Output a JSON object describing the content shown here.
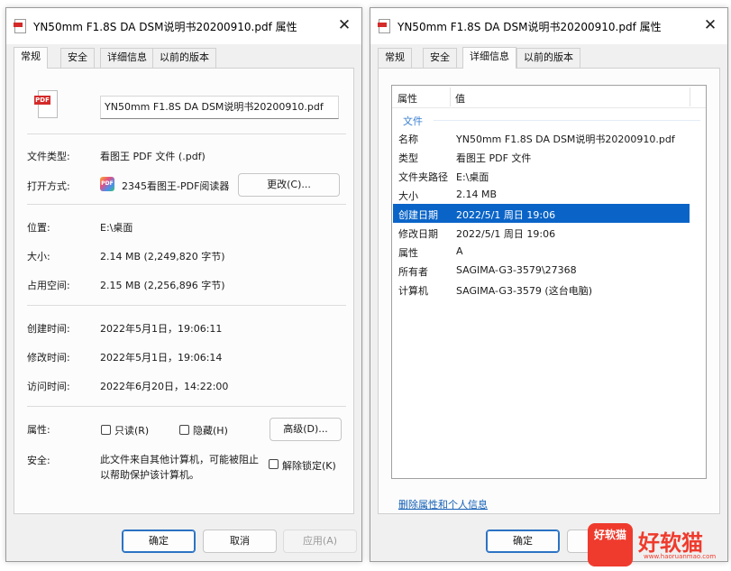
{
  "left_window": {
    "title": "YN50mm F1.8S DA DSM说明书20200910.pdf 属性",
    "tabs": [
      "常规",
      "安全",
      "详细信息",
      "以前的版本"
    ],
    "active_tab": "常规",
    "file_name": "YN50mm F1.8S DA DSM说明书20200910.pdf",
    "file_icon_text": "PDF",
    "file_type_label": "文件类型:",
    "file_type_value": "看图王 PDF 文件 (.pdf)",
    "open_with_label": "打开方式:",
    "open_with_value": "2345看图王-PDF阅读器",
    "app_icon_text": "PDF",
    "change_button": "更改(C)...",
    "location_label": "位置:",
    "location_value": "E:\\桌面",
    "size_label": "大小:",
    "size_value": "2.14 MB (2,249,820 字节)",
    "size_on_disk_label": "占用空间:",
    "size_on_disk_value": "2.15 MB (2,256,896 字节)",
    "created_label": "创建时间:",
    "created_value": "2022年5月1日，19:06:11",
    "modified_label": "修改时间:",
    "modified_value": "2022年5月1日，19:06:14",
    "accessed_label": "访问时间:",
    "accessed_value": "2022年6月20日，14:22:00",
    "attributes_label": "属性:",
    "readonly_label": "只读(R)",
    "hidden_label": "隐藏(H)",
    "advanced_button": "高级(D)...",
    "security_label": "安全:",
    "security_text_1": "此文件来自其他计算机，可能被阻止",
    "security_text_2": "以帮助保护该计算机。",
    "unblock_label": "解除锁定(K)",
    "ok_button": "确定",
    "cancel_button": "取消",
    "apply_button": "应用(A)"
  },
  "right_window": {
    "title": "YN50mm F1.8S DA DSM说明书20200910.pdf 属性",
    "tabs": [
      "常规",
      "安全",
      "详细信息",
      "以前的版本"
    ],
    "active_tab": "详细信息",
    "col_property": "属性",
    "col_value": "值",
    "group_file": "文件",
    "rows": [
      {
        "key": "名称",
        "value": "YN50mm F1.8S DA DSM说明书20200910.pdf"
      },
      {
        "key": "类型",
        "value": "看图王 PDF 文件"
      },
      {
        "key": "文件夹路径",
        "value": "E:\\桌面"
      },
      {
        "key": "大小",
        "value": "2.14 MB"
      },
      {
        "key": "创建日期",
        "value": "2022/5/1 周日 19:06"
      },
      {
        "key": "修改日期",
        "value": "2022/5/1 周日 19:06"
      },
      {
        "key": "属性",
        "value": "A"
      },
      {
        "key": "所有者",
        "value": "SAGIMA-G3-3579\\27368"
      },
      {
        "key": "计算机",
        "value": "SAGIMA-G3-3579 (这台电脑)"
      }
    ],
    "selected_row": "创建日期",
    "remove_link": "删除属性和个人信息",
    "ok_button": "确定"
  },
  "watermark": {
    "badge_text": "好软猫",
    "brand_text": "好软猫",
    "url": "www.haoruanmao.com"
  },
  "colors": {
    "selection": "#0a64c8",
    "link": "#1560b6",
    "group_header": "#3b7fd0",
    "watermark": "#ef3b2d"
  }
}
